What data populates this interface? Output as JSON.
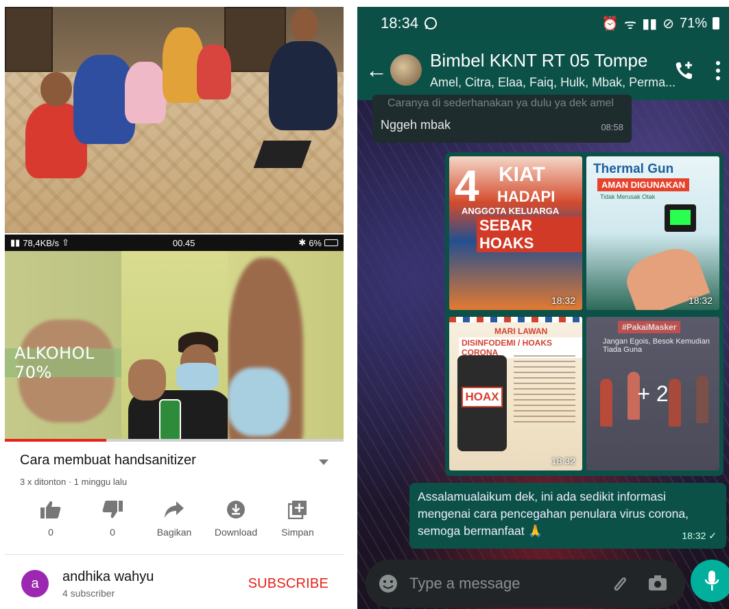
{
  "youtube": {
    "status_bar": {
      "network": "78,4KB/s",
      "time": "00.45",
      "battery": "6%"
    },
    "video": {
      "overlay_text": "ALKOHOL 70%",
      "progress": 0.3
    },
    "title": "Cara membuat handsanitizer",
    "meta": "3 x ditonton · 1 minggu lalu",
    "actions": [
      {
        "icon": "thumbs-up-icon",
        "label": "0"
      },
      {
        "icon": "thumbs-down-icon",
        "label": "0"
      },
      {
        "icon": "share-icon",
        "label": "Bagikan"
      },
      {
        "icon": "download-icon",
        "label": "Download"
      },
      {
        "icon": "save-playlist-icon",
        "label": "Simpan"
      }
    ],
    "channel": {
      "avatar_letter": "a",
      "name": "andhika wahyu",
      "subscribers": "4 subscriber",
      "subscribe_label": "SUBSCRIBE"
    },
    "colors": {
      "subscribe": "#e62117",
      "avatar": "#9c27b0"
    }
  },
  "whatsapp": {
    "status_bar": {
      "time": "18:34",
      "battery": "71%"
    },
    "header": {
      "title": "Bimbel KKNT RT 05 Tompe",
      "members": "Amel, Citra, Elaa, Faiq, Hulk, Mbak, Perma..."
    },
    "messages": {
      "partial_text": "Caranya di sederhanakan ya dulu ya dek amel",
      "incoming": {
        "text": "Nggeh mbak",
        "time": "08:58"
      },
      "album": {
        "tiles": [
          {
            "line1": "4",
            "line2": "KIAT",
            "line3": "HADAPI",
            "line4": "ANGGOTA KELUARGA",
            "line5": "SEBAR HOAKS",
            "time": "18:32"
          },
          {
            "line1": "Thermal Gun",
            "line2": "AMAN DIGUNAKAN",
            "line3": "Tidak Merusak Otak",
            "time": "18:32"
          },
          {
            "line1": "MARI LAWAN",
            "line2": "DISINFODEMI / HOAKS CORONA",
            "line3": "HOAX",
            "time": "18:32"
          },
          {
            "line1": "#PakaiMasker",
            "line2": "Jangan Egois, Besok Kemudian Tiada Guna",
            "more": "+ 2"
          }
        ]
      },
      "outgoing": {
        "text": "Assalamualaikum dek, ini ada sedikit informasi mengenai cara pencegahan penulara virus corona, semoga bermanfaat 🙏",
        "time": "18:32"
      }
    },
    "composer": {
      "placeholder": "Type a message"
    },
    "colors": {
      "header": "#0c5148",
      "mic": "#00af9c"
    }
  }
}
